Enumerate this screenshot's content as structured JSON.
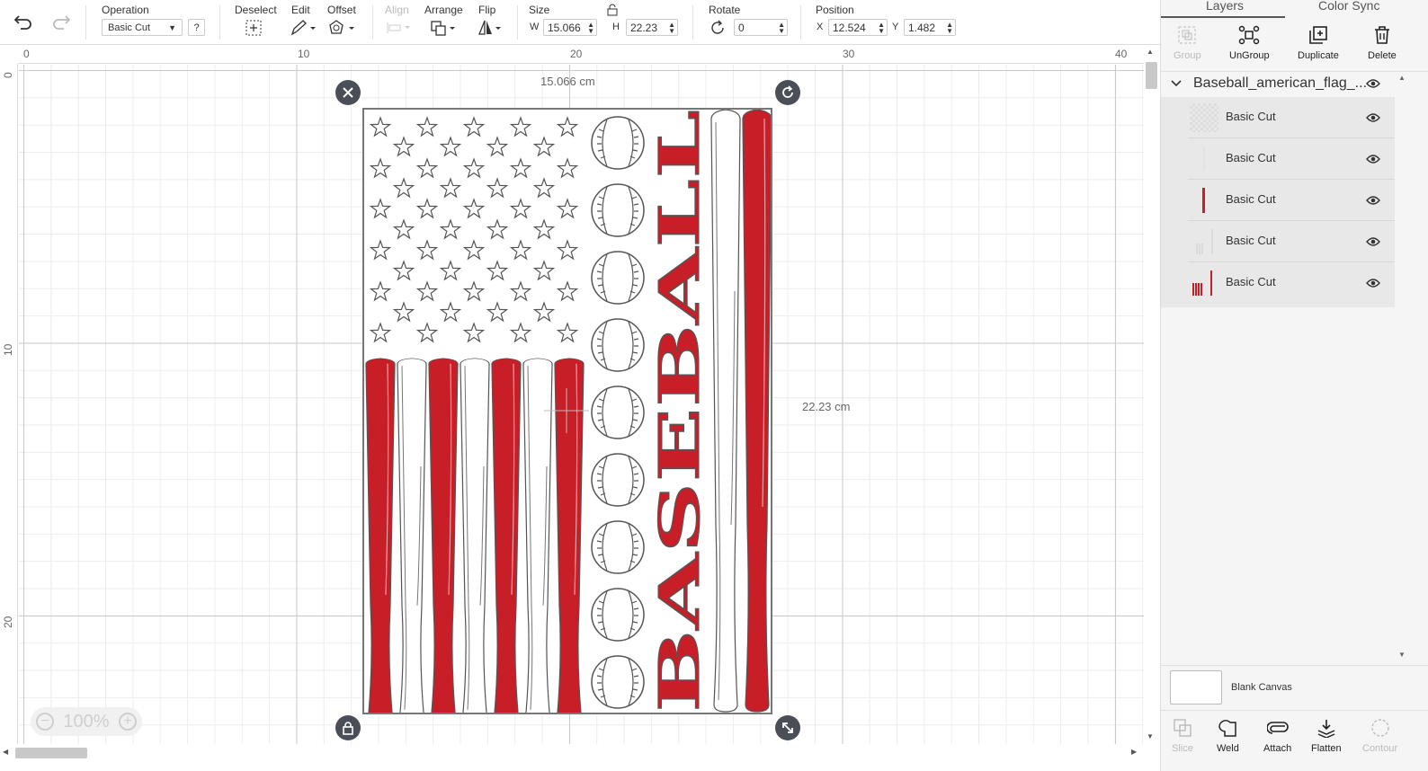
{
  "toolbar": {
    "operation_label": "Operation",
    "operation_value": "Basic Cut",
    "help_label": "?",
    "deselect_label": "Deselect",
    "edit_label": "Edit",
    "offset_label": "Offset",
    "align_label": "Align",
    "arrange_label": "Arrange",
    "flip_label": "Flip",
    "size_label": "Size",
    "size_w_letter": "W",
    "size_w_value": "15.066",
    "size_h_letter": "H",
    "size_h_value": "22.23",
    "rotate_label": "Rotate",
    "rotate_value": "0",
    "position_label": "Position",
    "pos_x_letter": "X",
    "pos_x_value": "12.524",
    "pos_y_letter": "Y",
    "pos_y_value": "1.482"
  },
  "canvas": {
    "ruler_top": [
      "0",
      "10",
      "20",
      "30",
      "40"
    ],
    "ruler_left": [
      "0",
      "10",
      "20"
    ],
    "width_label": "15.066 cm",
    "height_label": "22.23 cm",
    "zoom_value": "100%",
    "design_word": "BASEBALL",
    "accent_red": "#c81e28"
  },
  "panel": {
    "tab_layers": "Layers",
    "tab_color_sync": "Color Sync",
    "actions": {
      "group": "Group",
      "ungroup": "UnGroup",
      "duplicate": "Duplicate",
      "delete": "Delete"
    },
    "group_title": "Baseball_american_flag_...",
    "layers": [
      {
        "label": "Basic Cut"
      },
      {
        "label": "Basic Cut"
      },
      {
        "label": "Basic Cut"
      },
      {
        "label": "Basic Cut"
      },
      {
        "label": "Basic Cut"
      }
    ],
    "blank_canvas_label": "Blank Canvas",
    "bottom_actions": {
      "slice": "Slice",
      "weld": "Weld",
      "attach": "Attach",
      "flatten": "Flatten",
      "contour": "Contour"
    }
  }
}
